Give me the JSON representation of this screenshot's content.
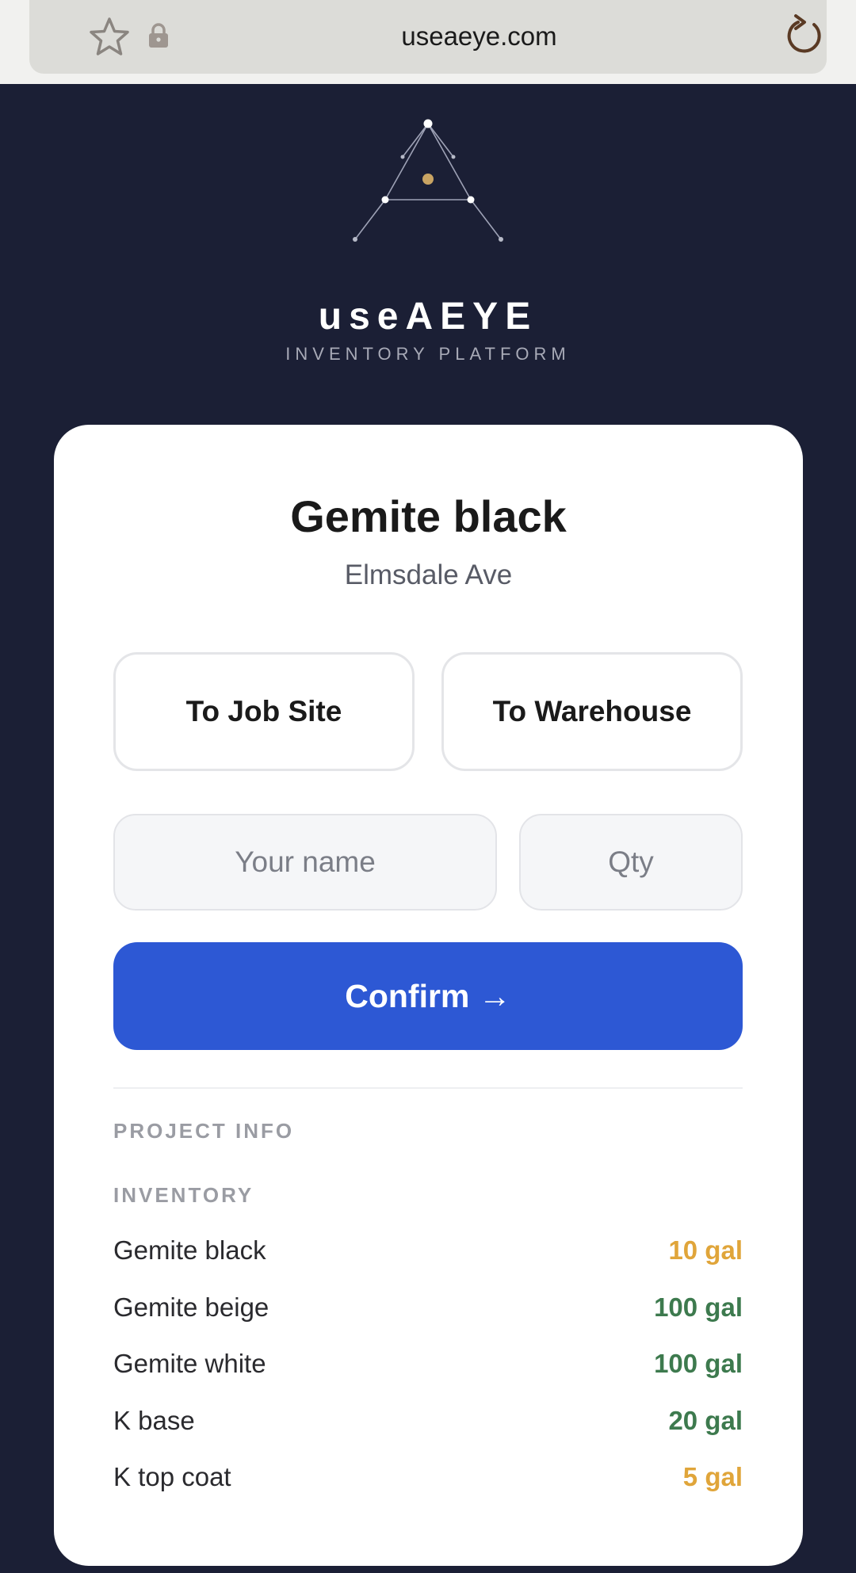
{
  "browser": {
    "url": "useaeye.com",
    "star_icon": "star-icon",
    "lock_icon": "lock-icon",
    "reload_icon": "reload-icon"
  },
  "brand": {
    "name": "useAEYE",
    "tagline": "INVENTORY PLATFORM",
    "logo_icon": "triangle-eye-logo"
  },
  "card": {
    "title": "Gemite black",
    "subtitle": "Elmsdale Ave",
    "buttons": {
      "to_job_site": "To Job Site",
      "to_warehouse": "To Warehouse",
      "confirm": "Confirm →"
    },
    "inputs": {
      "name": {
        "placeholder": "Your name",
        "value": ""
      },
      "qty": {
        "placeholder": "Qty",
        "value": ""
      }
    },
    "sections": {
      "project_info": "PROJECT INFO",
      "inventory": "INVENTORY"
    },
    "inventory": [
      {
        "name": "Gemite black",
        "qty": "10 gal",
        "status": "low"
      },
      {
        "name": "Gemite beige",
        "qty": "100 gal",
        "status": "ok"
      },
      {
        "name": "Gemite white",
        "qty": "100 gal",
        "status": "ok"
      },
      {
        "name": "K base",
        "qty": "20 gal",
        "status": "ok"
      },
      {
        "name": "K top coat",
        "qty": "5 gal",
        "status": "low"
      }
    ]
  },
  "colors": {
    "background": "#1b1f35",
    "accent": "#2d58d4",
    "logo_gold": "#c9a463",
    "qty_low": "#e0a53a",
    "qty_ok": "#3d7a4e"
  }
}
